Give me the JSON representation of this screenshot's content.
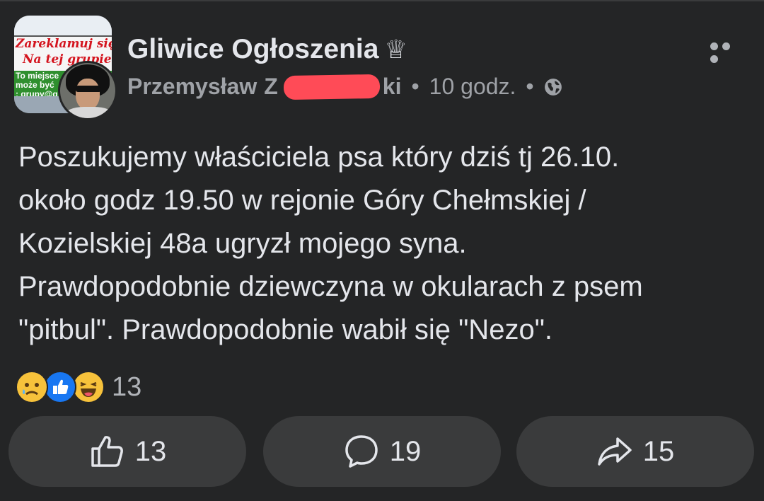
{
  "colors": {
    "background": "#242526",
    "button_background": "#3a3b3c",
    "primary_text": "#e4e6eb",
    "secondary_text": "#9fa2a7",
    "redaction": "#ff4b57",
    "like_blue": "#1877f2"
  },
  "header": {
    "group_name": "Gliwice Ogłoszenia",
    "crown_glyph": "♕",
    "group_avatar": {
      "line1": "Zareklamuj się",
      "line2": "Na tej grupie",
      "line3": "To miejsce",
      "line4": "może być",
      "line5": ": grupy@g"
    },
    "author_first": "Przemysław",
    "author_initial": "Z",
    "author_end": "ki",
    "dot": "•",
    "time": "10 godz.",
    "privacy_icon": "globe-icon",
    "more_icon": "more-options-icon"
  },
  "post": {
    "text": "Poszukujemy właściciela psa który dziś tj 26.10.\nokoło godz 19.50 w rejonie Góry Chełmskiej /\nKozielskiej 48a ugryzł mojego syna.\nPrawdopodobnie dziewczyna w okularach z psem\n\"pitbul\". Prawdopodobnie wabił się \"Nezo\"."
  },
  "reactions": {
    "icons": [
      "sad-icon",
      "like-icon",
      "haha-icon"
    ],
    "count": "13"
  },
  "actions": {
    "like_count": "13",
    "comment_count": "19",
    "share_count": "15"
  }
}
